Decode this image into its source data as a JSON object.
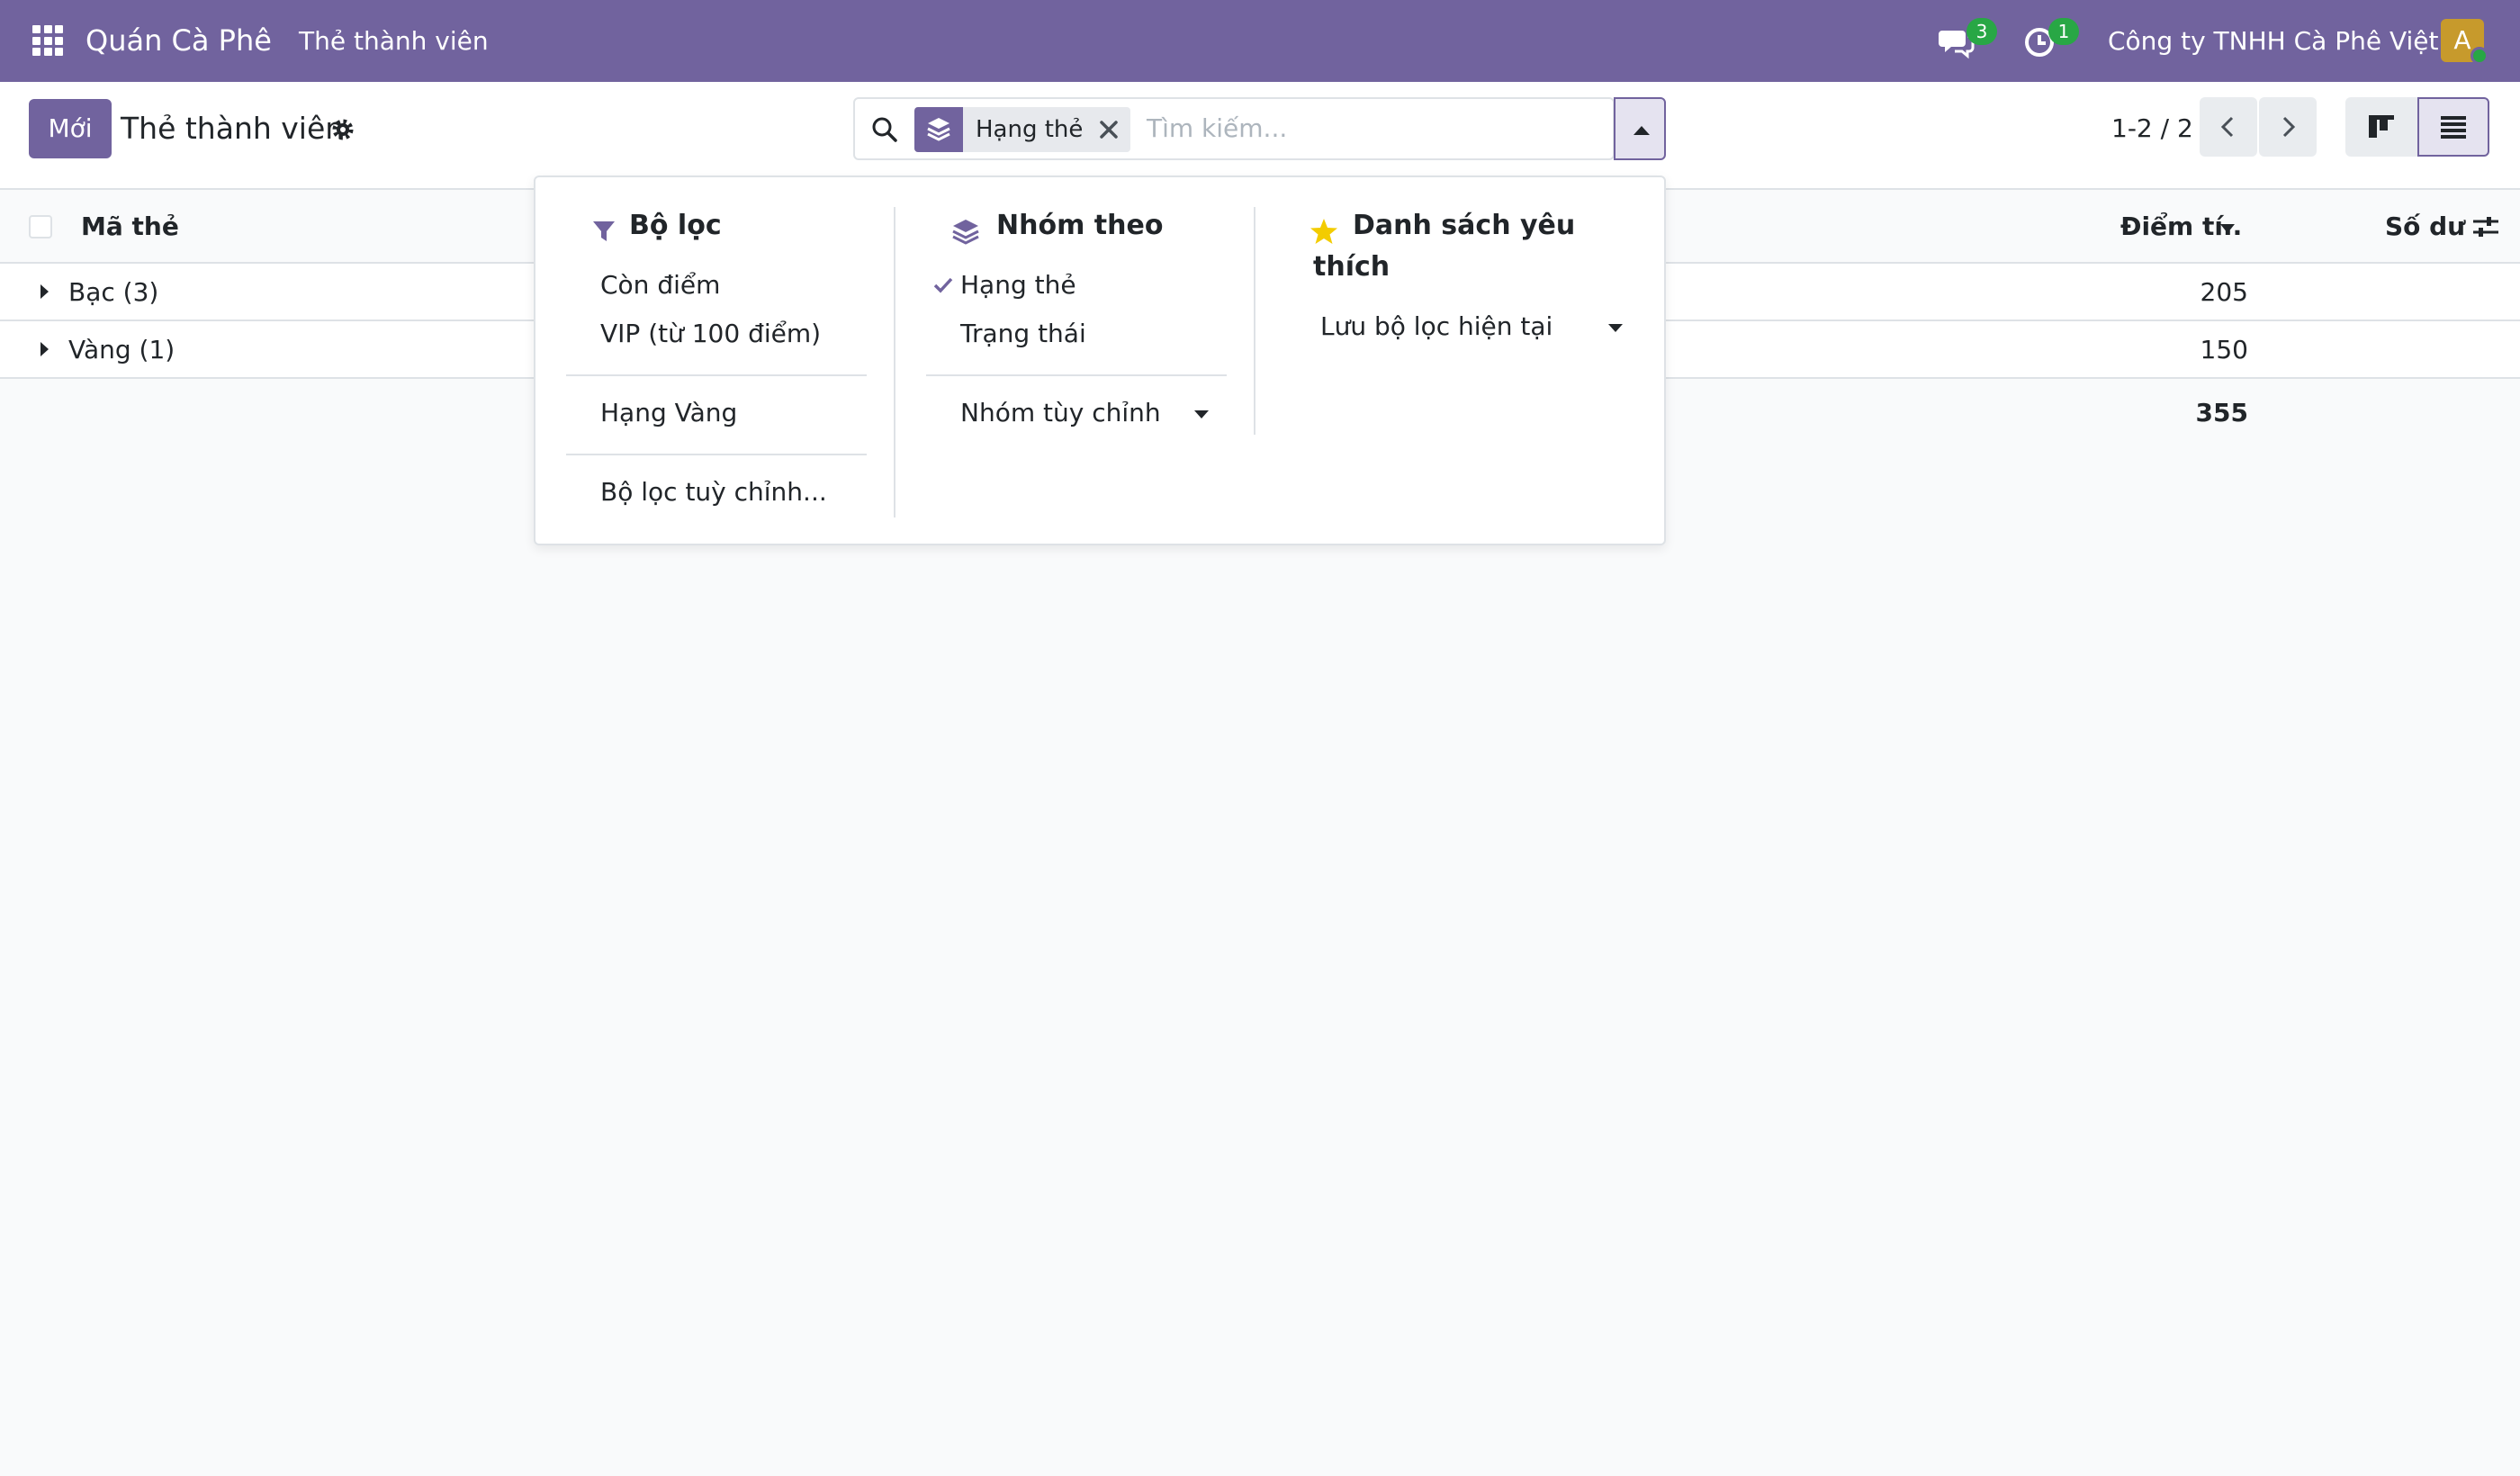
{
  "navbar": {
    "app_name": "Quán Cà Phê",
    "menu_item": "Thẻ thành viên",
    "messages_count": "3",
    "activities_count": "1",
    "company": "Công ty TNHH Cà Phê Việt",
    "avatar_letter": "A"
  },
  "control_panel": {
    "new_button": "Mới",
    "title": "Thẻ thành viên",
    "search": {
      "facet_label": "Hạng thẻ",
      "placeholder": "Tìm kiếm..."
    },
    "pager": "1-2 / 2"
  },
  "table": {
    "columns": [
      "Mã thẻ",
      "Điểm tí..",
      "Số dư"
    ],
    "groups": [
      {
        "label": "Bạc (3)",
        "points": "205"
      },
      {
        "label": "Vàng (1)",
        "points": "150"
      }
    ],
    "total_points": "355"
  },
  "dropdown": {
    "filters": {
      "title": "Bộ lọc",
      "items": [
        "Còn điểm",
        "VIP (từ 100 điểm)"
      ],
      "items2": [
        "Hạng Vàng"
      ],
      "custom": "Bộ lọc tuỳ chỉnh..."
    },
    "group_by": {
      "title": "Nhóm theo",
      "items": [
        "Hạng thẻ",
        "Trạng thái"
      ],
      "checked": "Hạng thẻ",
      "custom": "Nhóm tùy chỉnh"
    },
    "favorites": {
      "title_line1": "Danh sách yêu",
      "title_line2": "thích",
      "save": "Lưu bộ lọc hiện tại"
    }
  },
  "colors": {
    "brand": "#71639e",
    "badge": "#28a745",
    "star": "#f3cc00"
  }
}
